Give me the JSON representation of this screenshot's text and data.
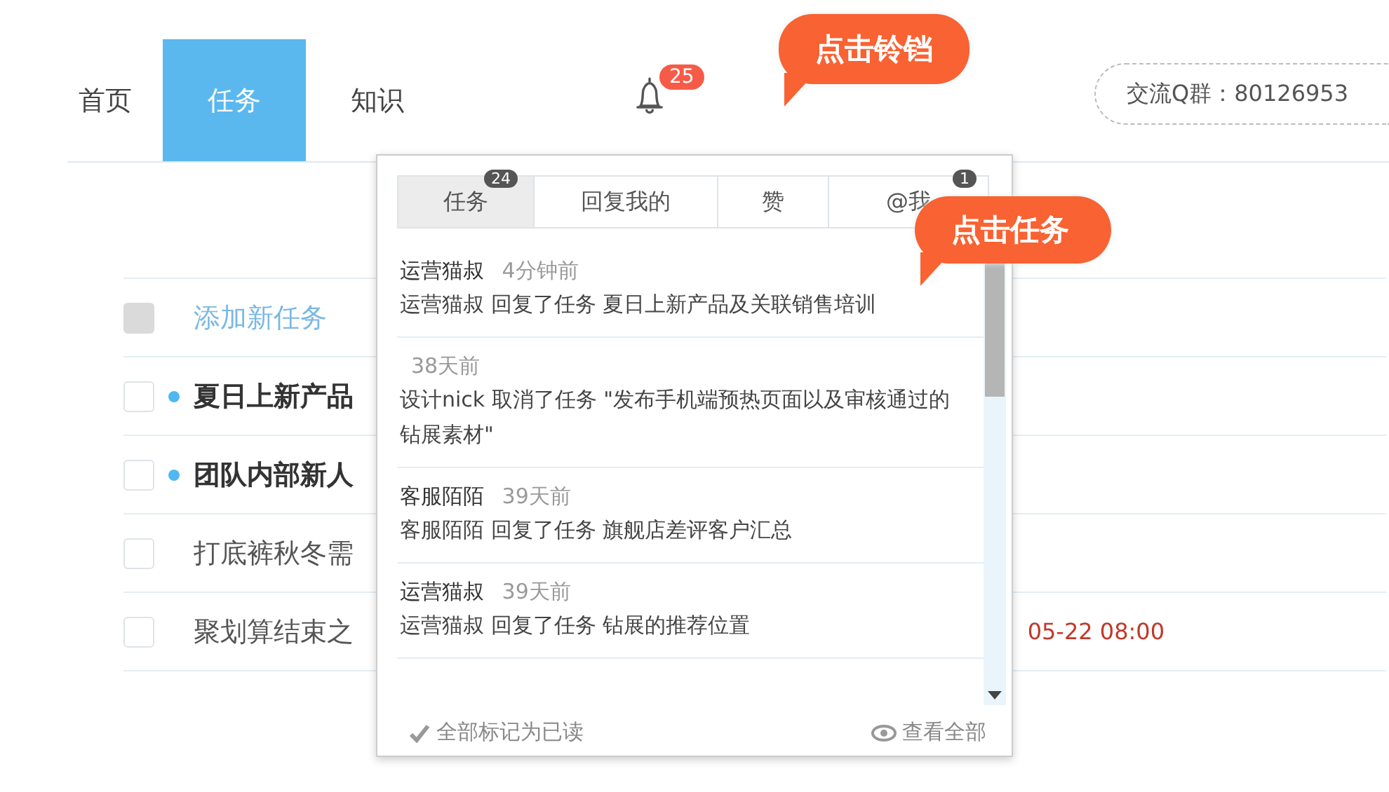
{
  "nav": {
    "tabs": [
      {
        "label": "首页",
        "selected": false
      },
      {
        "label": "任务",
        "selected": true
      },
      {
        "label": "知识",
        "selected": false
      }
    ],
    "bell_badge": "25",
    "qq_group": "交流Q群：80126953"
  },
  "callouts": [
    {
      "text": "点击铃铛"
    },
    {
      "text": "点击任务"
    }
  ],
  "task_list": {
    "add_label": "添加新任务",
    "add_checkbox_disabled": true,
    "rows": [
      {
        "title": "夏日上新产品",
        "unread": true,
        "checked": false
      },
      {
        "title": "团队内部新人",
        "unread": true,
        "checked": false
      },
      {
        "title": "打底裤秋冬需",
        "unread": false,
        "checked": false
      },
      {
        "title": "聚划算结束之",
        "unread": false,
        "checked": false,
        "due": "05-22 08:00"
      }
    ]
  },
  "notifications": {
    "tabs": [
      {
        "label": "任务",
        "selected": true,
        "badge": "24"
      },
      {
        "label": "回复我的",
        "selected": false
      },
      {
        "label": "赞",
        "selected": false
      },
      {
        "label": "@我",
        "selected": false,
        "badge": "1"
      }
    ],
    "items": [
      {
        "author": "运营猫叔",
        "time": "4分钟前",
        "text": "运营猫叔 回复了任务 夏日上新产品及关联销售培训"
      },
      {
        "time": "38天前",
        "text": "设计nick 取消了任务 \"发布手机端预热页面以及审核通过的钻展素材\""
      },
      {
        "author": "客服陌陌",
        "time": "39天前",
        "text": "客服陌陌 回复了任务 旗舰店差评客户汇总"
      },
      {
        "author": "运营猫叔",
        "time": "39天前",
        "text": "运营猫叔 回复了任务 钻展的推荐位置"
      }
    ],
    "mark_all_read": "全部标记为已读",
    "view_all": "查看全部"
  }
}
